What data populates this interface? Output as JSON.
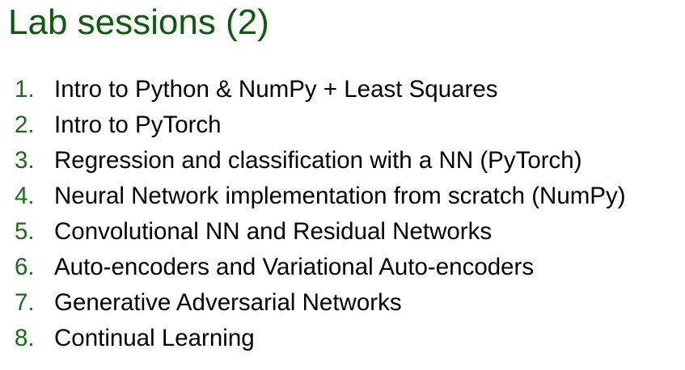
{
  "slide": {
    "title": "Lab sessions (2)",
    "items": [
      {
        "number": "1.",
        "text": "Intro to Python & NumPy + Least Squares"
      },
      {
        "number": "2.",
        "text": "Intro to PyTorch"
      },
      {
        "number": "3.",
        "text": "Regression and classification with a NN (PyTorch)"
      },
      {
        "number": "4.",
        "text": "Neural Network implementation from scratch (NumPy)"
      },
      {
        "number": "5.",
        "text": "Convolutional NN and Residual Networks"
      },
      {
        "number": "6.",
        "text": "Auto-encoders and Variational Auto-encoders"
      },
      {
        "number": "7.",
        "text": "Generative Adversarial Networks"
      },
      {
        "number": "8.",
        "text": "Continual Learning"
      }
    ]
  },
  "colors": {
    "title": "#0e5a0e",
    "number": "#1a6b1a",
    "text": "#000000",
    "background": "#ffffff"
  }
}
